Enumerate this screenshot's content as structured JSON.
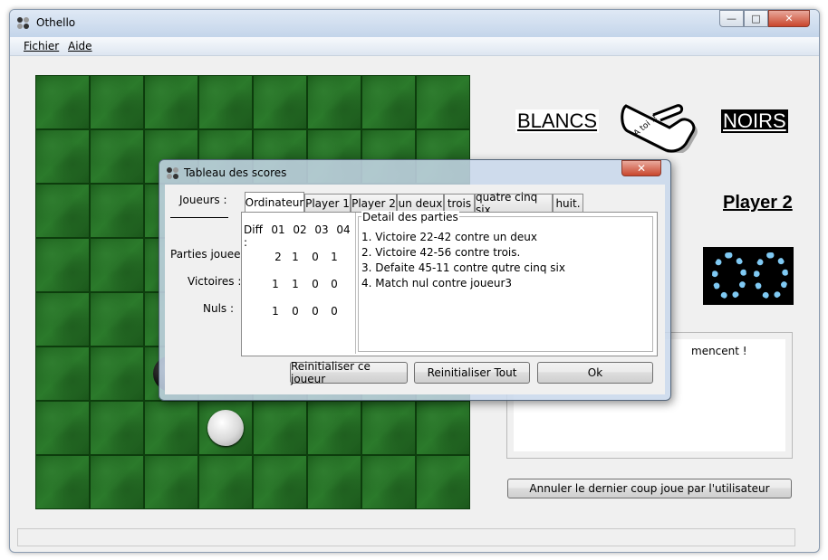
{
  "window": {
    "title": "Othello",
    "controls": {
      "minimize": "—",
      "maximize": "□",
      "close": "✕"
    }
  },
  "menu": {
    "items": [
      {
        "label": "Fichier"
      },
      {
        "label": "Aide"
      }
    ]
  },
  "board": {
    "rows": 8,
    "cols": 8,
    "pieces": [
      {
        "row": 6,
        "col": 3,
        "color": "white"
      },
      {
        "row": 5,
        "col": 2,
        "color": "black"
      }
    ]
  },
  "side_panel": {
    "white_label": "BLANCS",
    "black_label": "NOIRS",
    "hand_text": "A toi !!",
    "current_player": "Player 2",
    "score_digits": [
      "0",
      "8"
    ],
    "message": "mencent !",
    "undo_button": "Annuler le dernier coup joue par l'utilisateur"
  },
  "dialog": {
    "title": "Tableau des scores",
    "close": "✕",
    "players_label": "Joueurs :",
    "row_labels": {
      "games": "Parties jouees :",
      "wins": "Victoires :",
      "draws": "Nuls :"
    },
    "tabs": [
      {
        "label": "Ordinateur",
        "active": true
      },
      {
        "label": "Player 1",
        "active": false
      },
      {
        "label": "Player 2",
        "active": false
      },
      {
        "label": "un deux",
        "active": false
      },
      {
        "label": "trois",
        "active": false
      },
      {
        "label": "quatre cinq six",
        "active": false
      },
      {
        "label": "huit.",
        "active": false
      }
    ],
    "diff_label": "Diff :",
    "diff_columns": [
      "01",
      "02",
      "03",
      "04"
    ],
    "games": [
      "2",
      "1",
      "0",
      "1"
    ],
    "wins": [
      "1",
      "1",
      "0",
      "0"
    ],
    "draws": [
      "1",
      "0",
      "0",
      "0"
    ],
    "detail_title": "Detail des parties",
    "details": [
      "1. Victoire 22-42 contre un deux",
      "2. Victoire 42-56 contre trois.",
      "3. Defaite 45-11 contre qutre cinq six",
      "4. Match nul contre joueur3"
    ],
    "buttons": {
      "reset_player": "Reinitialiser ce joueur",
      "reset_all": "Reinitialiser Tout",
      "ok": "Ok"
    }
  }
}
